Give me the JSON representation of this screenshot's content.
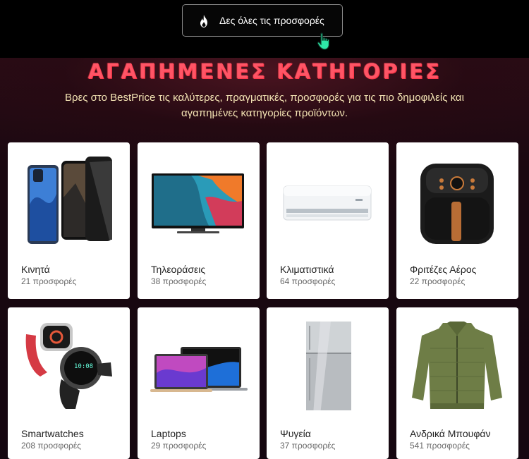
{
  "header": {
    "deals_button_label": "Δες όλες τις προσφορές",
    "deals_button_icon": "flame-icon"
  },
  "section": {
    "title": "ΑΓΑΠΗΜΕΝΕΣ ΚΑΤΗΓΟΡΙΕΣ",
    "subtitle": "Βρες στο BestPrice τις καλύτερες, πραγματικές, προσφορές για τις πιο δημοφιλείς και αγαπημένες κατηγορίες προϊόντων."
  },
  "categories": [
    {
      "name": "Κινητά",
      "count": "21 προσφορές",
      "icon": "smartphone-image"
    },
    {
      "name": "Τηλεοράσεις",
      "count": "38 προσφορές",
      "icon": "television-image"
    },
    {
      "name": "Κλιματιστικά",
      "count": "64 προσφορές",
      "icon": "air-conditioner-image"
    },
    {
      "name": "Φριτέζες Αέρος",
      "count": "22 προσφορές",
      "icon": "air-fryer-image"
    },
    {
      "name": "Smartwatches",
      "count": "208 προσφορές",
      "icon": "smartwatch-image"
    },
    {
      "name": "Laptops",
      "count": "29 προσφορές",
      "icon": "laptop-image"
    },
    {
      "name": "Ψυγεία",
      "count": "37 προσφορές",
      "icon": "refrigerator-image"
    },
    {
      "name": "Ανδρικά Μπουφάν",
      "count": "541 προσφορές",
      "icon": "jacket-image"
    }
  ],
  "colors": {
    "title": "#b01c2c",
    "subtitle": "#f3e3b3",
    "background": "#1c0a10"
  }
}
